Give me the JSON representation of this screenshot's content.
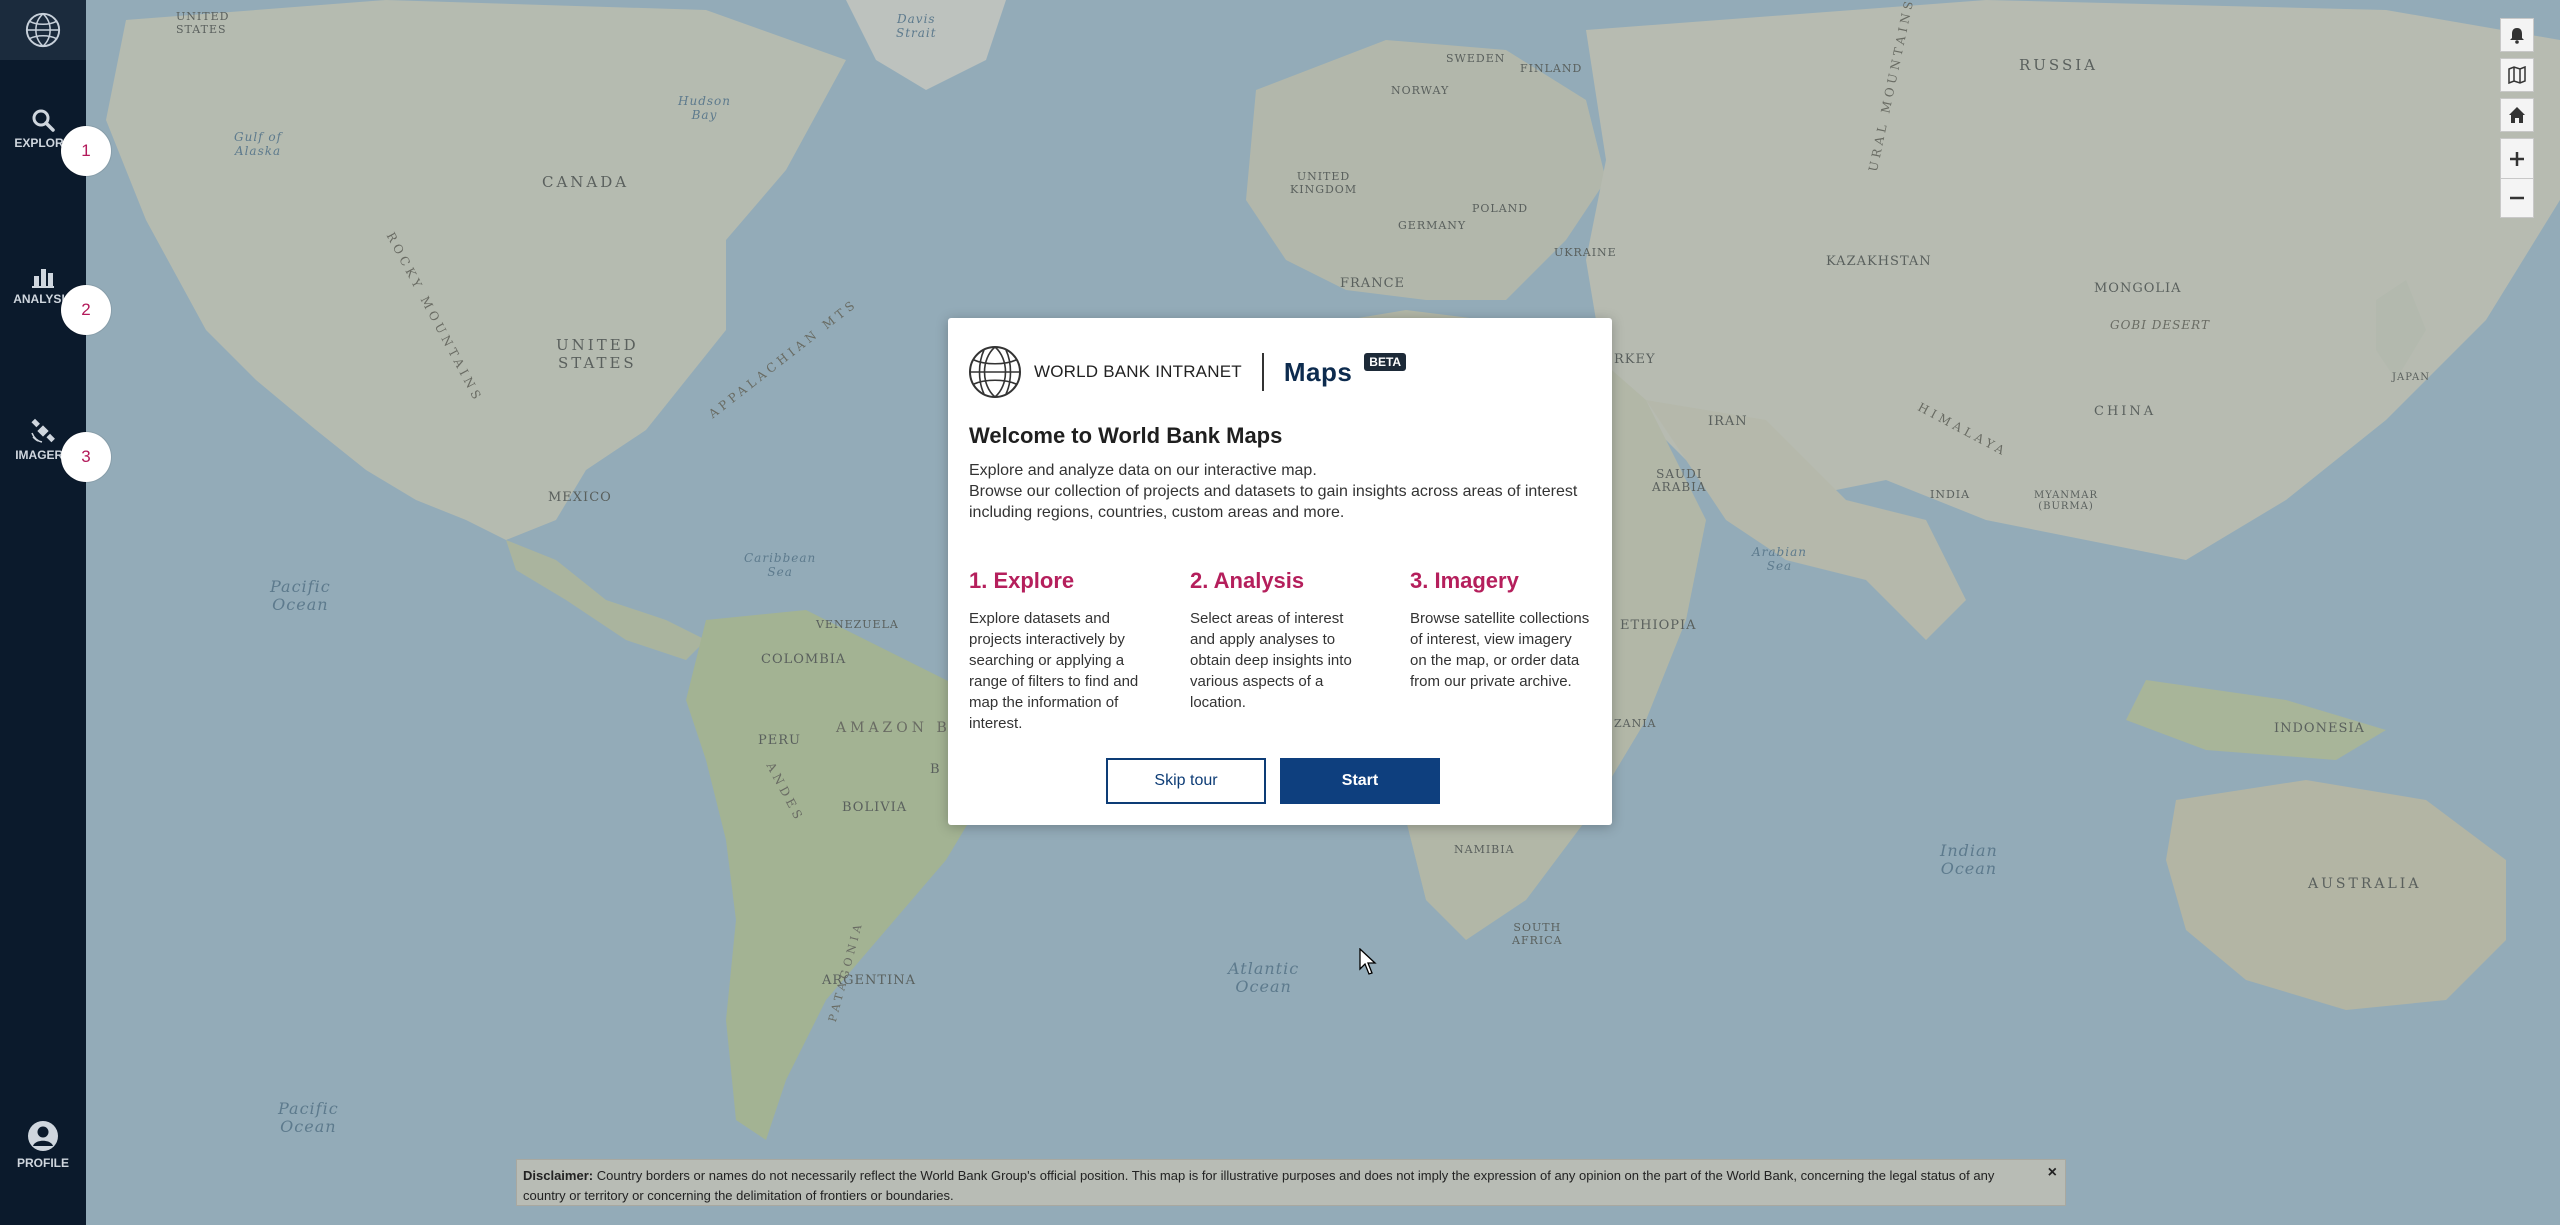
{
  "sidebar": {
    "logo_icon": "globe-icon",
    "items": [
      {
        "label": "EXPLORE",
        "icon": "search-icon",
        "marker": "1"
      },
      {
        "label": "ANALYSIS",
        "icon": "bar-chart-icon",
        "marker": "2"
      },
      {
        "label": "IMAGERY",
        "icon": "satellite-icon",
        "marker": "3"
      }
    ],
    "profile": {
      "label": "PROFILE",
      "icon": "user-icon"
    }
  },
  "map_controls": [
    {
      "name": "notifications",
      "icon": "bell-icon"
    },
    {
      "name": "basemap",
      "icon": "map-icon"
    },
    {
      "name": "home",
      "icon": "home-icon"
    },
    {
      "name": "zoom-in",
      "icon": "plus-icon"
    },
    {
      "name": "zoom-out",
      "icon": "minus-icon"
    }
  ],
  "map_labels": {
    "countries": [
      "UNITED STATES",
      "CANADA",
      "UNITED STATES",
      "MEXICO",
      "VENEZUELA",
      "COLOMBIA",
      "PERU",
      "BOLIVIA",
      "ARGENTINA",
      "SWEDEN",
      "FINLAND",
      "NORWAY",
      "UNITED KINGDOM",
      "POLAND",
      "GERMANY",
      "UKRAINE",
      "FRANCE",
      "RUSSIA",
      "KAZAKHSTAN",
      "MONGOLIA",
      "CHINA",
      "IRAN",
      "SAUDI ARABIA",
      "INDIA",
      "MYANMAR (BURMA)",
      "JAPAN",
      "ETHIOPIA",
      "NAMIBIA",
      "SOUTH AFRICA",
      "INDONESIA",
      "AUSTRALIA",
      "RKEY",
      "ZANIA",
      "B"
    ],
    "oceans": [
      "Pacific Ocean",
      "Pacific Ocean",
      "Atlantic Ocean",
      "Indian Ocean",
      "Arabian Sea",
      "Caribbean Sea",
      "Gulf of Alaska",
      "Hudson Bay",
      "Davis Strait"
    ],
    "features": [
      "ROCKY MOUNTAINS",
      "APPALACHIAN MTS",
      "AMAZON BA",
      "ANDES",
      "PATAGONIA",
      "URAL MOUNTAINS",
      "HIMALAYA",
      "GOBI DESERT"
    ]
  },
  "modal": {
    "brand_name": "WORLD BANK INTRANET",
    "app_name": "Maps",
    "beta_badge": "BETA",
    "title": "Welcome to World Bank Maps",
    "intro_line1": "Explore and analyze data on our interactive map.",
    "intro_line2": "Browse our collection of projects and datasets to gain insights across areas of interest including regions, countries, custom areas and more.",
    "steps": [
      {
        "title": "1. Explore",
        "text": "Explore datasets and projects interactively by searching or applying a range of filters to find and map the information of interest."
      },
      {
        "title": "2. Analysis",
        "text": "Select areas of interest and apply analyses to obtain deep insights into various aspects of a location."
      },
      {
        "title": "3. Imagery",
        "text": "Browse satellite collections of interest, view imagery on the map, or order data from our private archive."
      }
    ],
    "skip_label": "Skip tour",
    "start_label": "Start"
  },
  "disclaimer": {
    "label": "Disclaimer:",
    "text": "Country borders or names do not necessarily reflect the World Bank Group's official position. This map is for illustrative purposes and does not imply the expression of any opinion on the part of the World Bank, concerning the legal status of any country or territory or concerning the delimitation of frontiers or boundaries.",
    "close": "×"
  },
  "colors": {
    "sidebar_bg": "#0b1a2c",
    "accent_magenta": "#b51f5c",
    "primary_blue": "#0e3f7e",
    "ocean": "#a9c3cd",
    "land": "#d8d6c4"
  }
}
